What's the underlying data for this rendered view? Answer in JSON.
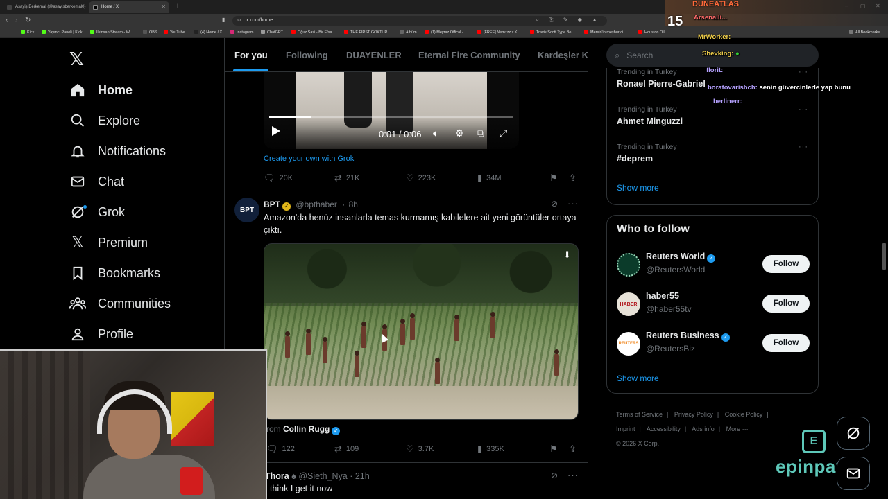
{
  "browser": {
    "tabs": [
      {
        "title": "Asayiş Berkemal (@asayisberkemal0)"
      },
      {
        "title": "Home / X"
      }
    ],
    "url": "x.com/home",
    "bookmarks": [
      "Kick",
      "Yayıncı Paneli | Kick",
      "İlkinsan Stream - W...",
      "OBS",
      "YouTube",
      "(4) Home / X",
      "Instagram",
      "ChatGPT",
      "Oğuz Sasi - Bir Efsa...",
      "THE FIRST GOKTUR...",
      "Albüm",
      "(1) Meyraz Offical -...",
      "[FREE] Nemzzz x K...",
      "Travis Scott Type Be...",
      "Mersin'in meşhur ci...",
      "Houston Oil..."
    ],
    "all_bookmarks": "All Bookmarks"
  },
  "nav": {
    "items": [
      {
        "key": "home",
        "label": "Home"
      },
      {
        "key": "explore",
        "label": "Explore"
      },
      {
        "key": "notifications",
        "label": "Notifications"
      },
      {
        "key": "chat",
        "label": "Chat"
      },
      {
        "key": "grok",
        "label": "Grok"
      },
      {
        "key": "premium",
        "label": "Premium"
      },
      {
        "key": "bookmarks",
        "label": "Bookmarks"
      },
      {
        "key": "communities",
        "label": "Communities"
      },
      {
        "key": "profile",
        "label": "Profile"
      }
    ]
  },
  "timeline_tabs": [
    "For you",
    "Following",
    "DUAYENLER",
    "Eternal Fire Community",
    "Kardeşler Ki"
  ],
  "video_tweet": {
    "time": "0:01 / 0:06",
    "progress": 0.17,
    "grok_link": "Create your own with Grok",
    "replies": "20K",
    "reposts": "21K",
    "likes": "223K",
    "views": "34M"
  },
  "bpt_tweet": {
    "avatar_text": "BPT",
    "name": "BPT",
    "handle": "@bpthaber",
    "time": "8h",
    "text": "Amazon'da henüz insanlarla temas kurmamış kabilelere ait yeni görüntüler ortaya çıktı.",
    "from_prefix": "rom",
    "from_user": "Collin Rugg",
    "replies": "122",
    "reposts": "109",
    "likes": "3.7K",
    "views": "335K"
  },
  "thora_tweet": {
    "name": "Thora",
    "handle": "@Sieth_Nya",
    "time": "21h",
    "text": "I think I get it now"
  },
  "sidebar": {
    "search_placeholder": "Search",
    "trends": [
      {
        "context": "Trending in Turkey",
        "name": "Ronael Pierre-Gabriel"
      },
      {
        "context": "Trending in Turkey",
        "name": "Ahmet Minguzzi"
      },
      {
        "context": "Trending in Turkey",
        "name": "#deprem"
      }
    ],
    "trends_show_more": "Show more",
    "who_to_follow_title": "Who to follow",
    "suggestions": [
      {
        "name": "Reuters World",
        "handle": "@ReutersWorld",
        "verified": true,
        "button": "Follow"
      },
      {
        "name": "haber55",
        "handle": "@haber55tv",
        "verified": false,
        "button": "Follow",
        "avatar_text": "HABER"
      },
      {
        "name": "Reuters Business",
        "handle": "@ReutersBiz",
        "verified": true,
        "button": "Follow",
        "avatar_text": "REUTERS"
      }
    ],
    "wtf_show_more": "Show more",
    "footer": [
      "Terms of Service",
      "Privacy Policy",
      "Cookie Policy",
      "Imprint",
      "Accessibility",
      "Ads info",
      "More ···",
      "© 2026 X Corp."
    ]
  },
  "stream_overlay": {
    "top_alert": "DUNEATLAS",
    "count": "15",
    "chat": [
      {
        "user": "Arsenalli...",
        "message": ""
      },
      {
        "user": "MrWorker:",
        "message": ""
      },
      {
        "user": "Shevking:",
        "message": ""
      },
      {
        "user": "florit:",
        "message": ""
      },
      {
        "user": "boratovarishch:",
        "message": "senin güvercinlerle yap bunu"
      },
      {
        "user": "berlinerr:",
        "message": ""
      }
    ],
    "sponsor": "epinpay"
  },
  "colors": {
    "accent": "#1d9bf0",
    "background": "#000000",
    "muted": "#71767b",
    "border": "#2f3336",
    "sponsor": "#5ec8b9"
  }
}
